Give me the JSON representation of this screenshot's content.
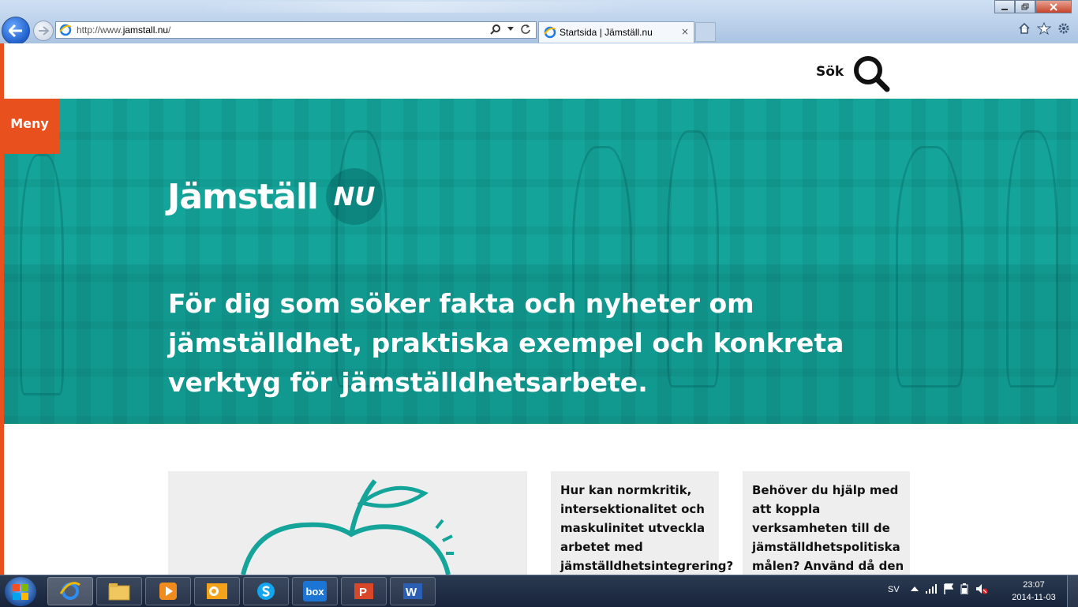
{
  "browser": {
    "address_prefix": "http://www.",
    "address_domain": "jamstall.nu",
    "address_suffix": "/",
    "tab_title": "Startsida | Jämställ.nu",
    "tab_close": "×"
  },
  "page": {
    "search_label": "Sök",
    "menu_label": "Meny",
    "logo_text": "Jämställ",
    "logo_badge": "NU",
    "tagline": "För dig som söker fakta och nyheter om jämställdhet, praktiska exempel och konkreta verktyg för jämställdhetsarbete.",
    "cards": [
      {
        "text": ""
      },
      {
        "text": "Hur kan normkritik, intersektionalitet och maskulinitet utveckla arbetet med jämställdhetsintegrering?"
      },
      {
        "text": "Behöver du hjälp med att koppla verksamheten till de jämställdhetspolitiska målen? Använd då den"
      }
    ],
    "colors": {
      "accent": "#e8501e",
      "hero": "#14a49a"
    }
  },
  "taskbar": {
    "language": "SV",
    "time": "23:07",
    "date": "2014-11-03",
    "apps": [
      "internet-explorer",
      "file-explorer",
      "media-player",
      "outlook",
      "skype",
      "box",
      "powerpoint",
      "word"
    ],
    "box_label": "box"
  }
}
